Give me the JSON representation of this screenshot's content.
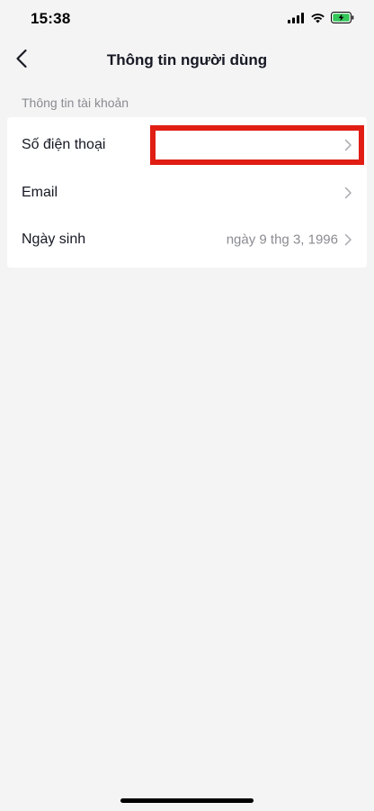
{
  "status_bar": {
    "time": "15:38",
    "icons": [
      "cellular-signal-icon",
      "wifi-icon",
      "battery-charging-icon"
    ]
  },
  "header": {
    "title": "Thông tin người dùng",
    "back_icon": "chevron-left-icon"
  },
  "section": {
    "title": "Thông tin tài khoản"
  },
  "rows": [
    {
      "label": "Số điện thoại",
      "value": ""
    },
    {
      "label": "Email",
      "value": ""
    },
    {
      "label": "Ngày sinh",
      "value": "ngày 9 thg 3, 1996"
    }
  ],
  "colors": {
    "background": "#f4f4f4",
    "card": "#ffffff",
    "primary_text": "#161823",
    "secondary_text": "#8a8b91",
    "highlight": "#e01e14",
    "battery_green": "#34c759"
  }
}
